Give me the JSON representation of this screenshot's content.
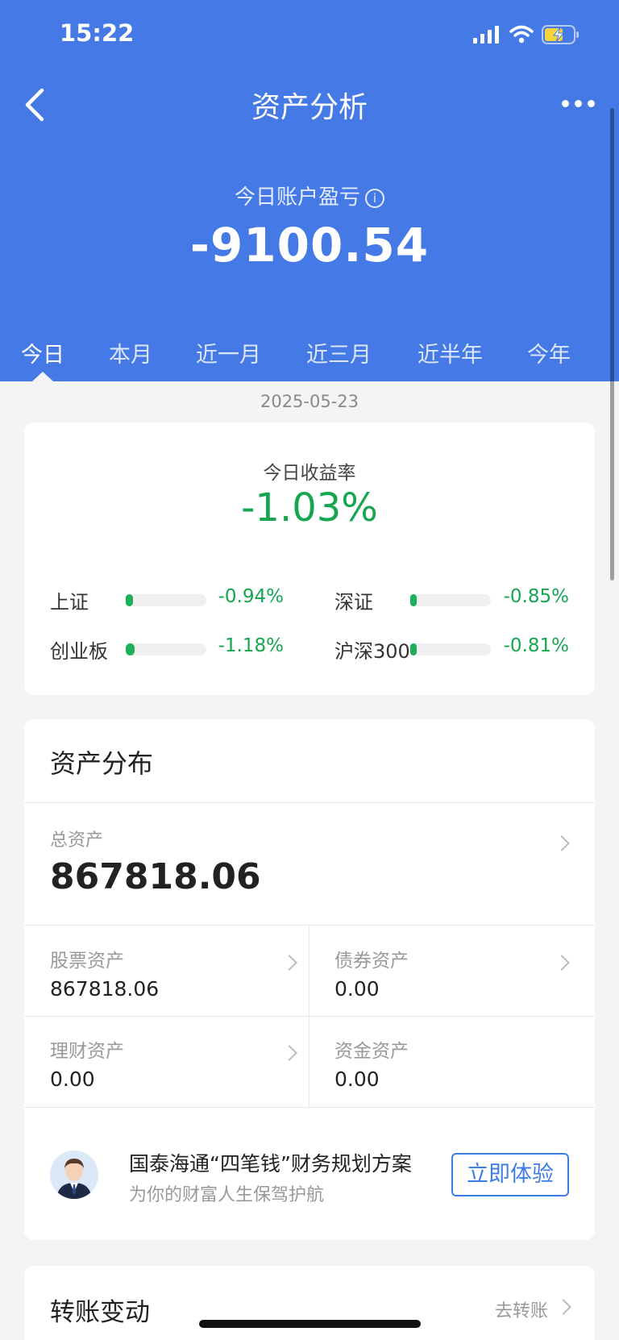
{
  "status_bar": {
    "time": "15:22"
  },
  "nav": {
    "title": "资产分析"
  },
  "pnl": {
    "label": "今日账户盈亏",
    "value": "-9100.54"
  },
  "tabs": [
    {
      "label": "今日",
      "active": true
    },
    {
      "label": "本月",
      "active": false
    },
    {
      "label": "近一月",
      "active": false
    },
    {
      "label": "近三月",
      "active": false
    },
    {
      "label": "近半年",
      "active": false
    },
    {
      "label": "今年",
      "active": false
    }
  ],
  "date": "2025-05-23",
  "yield_card": {
    "label": "今日收益率",
    "value": "-1.03%",
    "indices": [
      {
        "name": "上证",
        "value": "-0.94%"
      },
      {
        "name": "深证",
        "value": "-0.85%"
      },
      {
        "name": "创业板",
        "value": "-1.18%"
      },
      {
        "name": "沪深300",
        "value": "-0.81%"
      }
    ]
  },
  "assets": {
    "title": "资产分布",
    "total_label": "总资产",
    "total_value": "867818.06",
    "cells": [
      {
        "label": "股票资产",
        "value": "867818.06"
      },
      {
        "label": "债券资产",
        "value": "0.00"
      },
      {
        "label": "理财资产",
        "value": "0.00"
      },
      {
        "label": "资金资产",
        "value": "0.00"
      }
    ],
    "promo": {
      "title": "国泰海通“四笔钱”财务规划方案",
      "subtitle": "为你的财富人生保驾护航",
      "button": "立即体验"
    }
  },
  "transfer": {
    "title": "转账变动",
    "link": "去转账"
  },
  "colors": {
    "primary_blue": "#4479e6",
    "down_green": "#16a651",
    "accent_blue": "#3d7ee6"
  }
}
